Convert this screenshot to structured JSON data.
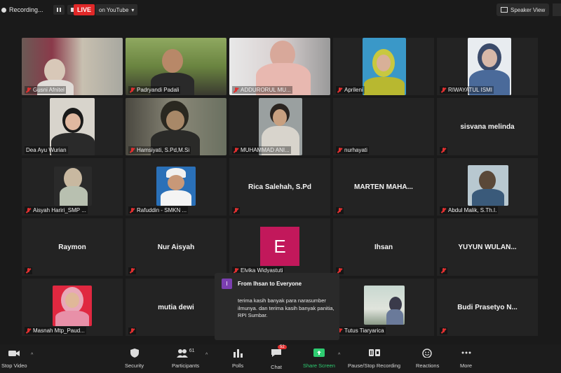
{
  "topbar": {
    "recording_label": "Recording...",
    "live_label": "LIVE",
    "stream_target": "on YouTube",
    "view_label": "Speaker View"
  },
  "participants": [
    {
      "name": "Gusni Afnitel",
      "muted": true
    },
    {
      "name": "Padryandi Padali",
      "muted": true
    },
    {
      "name": "ADDURORUL MU...",
      "muted": true
    },
    {
      "name": "Aprileni",
      "muted": true
    },
    {
      "name": "RIWAYATUL ISMI",
      "muted": true
    },
    {
      "name": "Dea Ayu Wurian",
      "muted": false
    },
    {
      "name": "Hamsiyati, S.Pd,M.Si",
      "muted": true
    },
    {
      "name": "MUHAMMAD ANI...",
      "muted": true
    },
    {
      "name": "nurhayati",
      "muted": true
    },
    {
      "name": "sisvana melinda",
      "muted": true,
      "display": "sisvana melinda"
    },
    {
      "name": "Aisyah Hariri_SMP ...",
      "muted": true
    },
    {
      "name": "Rafuddin - SMKN ...",
      "muted": true
    },
    {
      "name": "Rica Salehah, S.Pd",
      "muted": true,
      "display": "Rica Salehah, S.Pd"
    },
    {
      "name": "MARTEN MAHA...",
      "muted": true,
      "display": "MARTEN MAHA..."
    },
    {
      "name": "Abdul Malik, S.Th.I.",
      "muted": true
    },
    {
      "name": "Raymon",
      "muted": true,
      "display": "Raymon"
    },
    {
      "name": "Nur Aisyah",
      "muted": true,
      "display": "Nur Aisyah"
    },
    {
      "name": "Elvika Widyastuti",
      "muted": true,
      "avatar_letter": "E"
    },
    {
      "name": "Ihsan",
      "muted": true,
      "display": "Ihsan"
    },
    {
      "name": "YUYUN WULAN...",
      "muted": true,
      "display": "YUYUN WULAN..."
    },
    {
      "name": "Masnah Mtp_Paud...",
      "muted": true
    },
    {
      "name": "mutia dewi",
      "muted": true,
      "display": "mutia dewi"
    },
    {
      "name": "Tutus Tiaryarica",
      "muted": true
    },
    {
      "name": "Budi Prasetyo N...",
      "muted": true,
      "display": "Budi Prasetyo N..."
    }
  ],
  "chat_popup": {
    "avatar_letter": "I",
    "header": "From Ihsan to Everyone",
    "message": "terima kasih banyak para narasumber ilmunya. dan terima kasih banyak panitia, RPI Sumbar."
  },
  "toolbar": {
    "stop_video": "Stop Video",
    "security": "Security",
    "participants": "Participants",
    "participants_count": "61",
    "polls": "Polls",
    "chat": "Chat",
    "chat_badge": "52",
    "share_screen": "Share Screen",
    "record": "Pause/Stop Recording",
    "reactions": "Reactions",
    "more": "More"
  },
  "colors": {
    "live": "#e02828",
    "share": "#2ecc71",
    "muted_icon": "#e03030",
    "avatar_e": "#c2185b"
  }
}
